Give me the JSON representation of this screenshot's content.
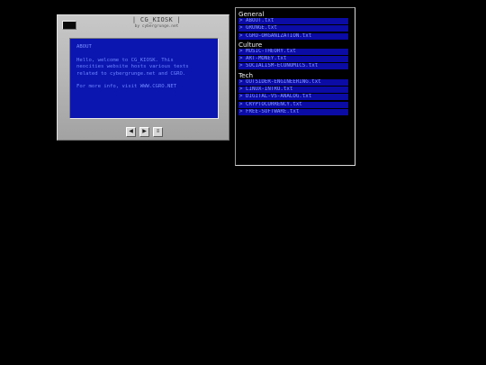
{
  "kiosk": {
    "title": "| CG_KIOSK |",
    "subtitle": "by cybergrunge.net",
    "screen": {
      "heading": "ABOUT",
      "lines": [
        "Hello, welcome to CG_KIOSK. This",
        "neocities website hosts various texts",
        "related to cybergrunge.net and CGRO."
      ],
      "footer": "For more info, visit WWW.CGRO.NET"
    },
    "buttons": [
      {
        "label": "◀",
        "icon": "previous-icon"
      },
      {
        "label": "▶",
        "icon": "next-icon"
      },
      {
        "label": "≡",
        "icon": "menu-icon"
      }
    ]
  },
  "files": {
    "categories": [
      {
        "name": "General",
        "items": [
          "> ABOUT.txt",
          "> GRUNGE.txt",
          "> CGRO-ORGANIZATION.txt"
        ]
      },
      {
        "name": "Culture",
        "items": [
          "> MUSIC-THEORY.txt",
          "> ART-MONEY.txt",
          "> SOCIALISM-ECONOMICS.txt"
        ]
      },
      {
        "name": "Tech",
        "items": [
          "> OUTSIDER-ENGINEERING.txt",
          "> LINUX-INTRO.txt",
          "> DIGITAL-VS-ANALOG.txt",
          "> CRYPTOCURRENCY.txt",
          "> FREE-SOFTWARE.txt"
        ]
      }
    ]
  },
  "colors": {
    "background": "#000000",
    "screen": "#0b16b0",
    "screen_text": "#6f86ff",
    "file_item_bg": "#0b0ba6",
    "file_item_text": "#8a9bff"
  }
}
